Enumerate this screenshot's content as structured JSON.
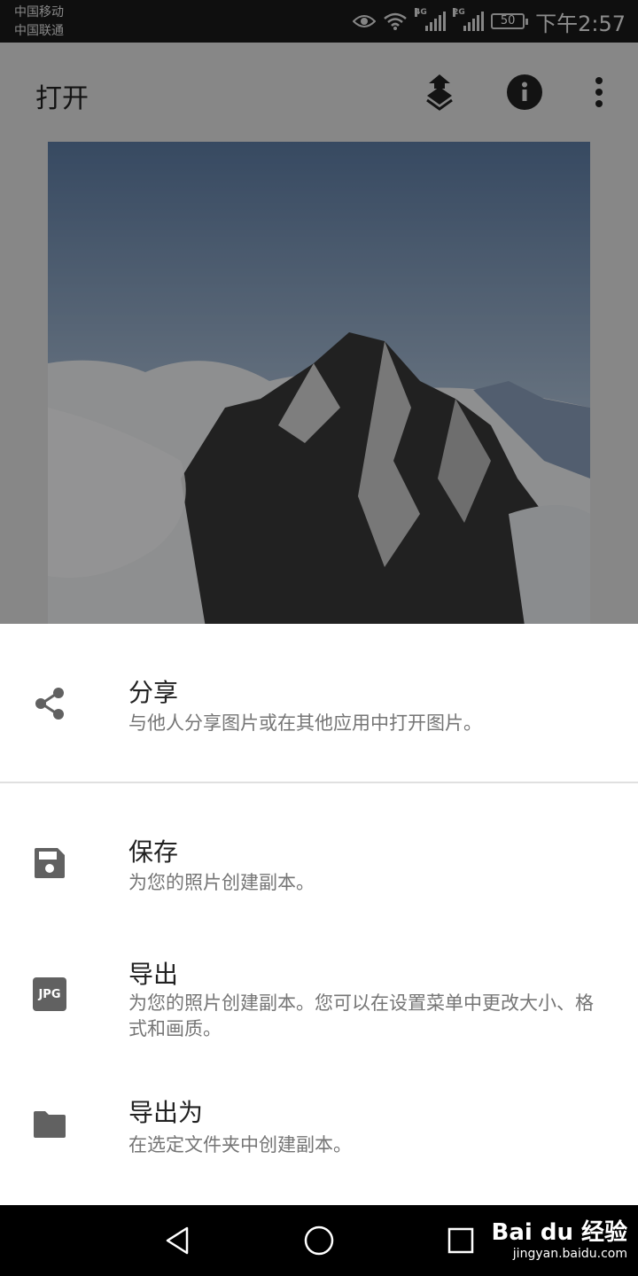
{
  "status_bar": {
    "carrier_1": "中国移动",
    "carrier_2": "中国联通",
    "signal_1_tag": "4G",
    "signal_2_tag": "2G",
    "battery": "50",
    "time": "下午2:57"
  },
  "app_bar": {
    "title": "打开",
    "actions": [
      "layers-icon",
      "info-icon",
      "more-vert-icon"
    ]
  },
  "sheet": {
    "items": [
      {
        "icon": "share-icon",
        "title": "分享",
        "description": "与他人分享图片或在其他应用中打开图片。"
      },
      {
        "icon": "save-icon",
        "title": "保存",
        "description": "为您的照片创建副本。"
      },
      {
        "icon": "jpg-icon",
        "icon_text": "JPG",
        "title": "导出",
        "description": "为您的照片创建副本。您可以在设置菜单中更改大小、格式和画质。"
      },
      {
        "icon": "folder-icon",
        "title": "导出为",
        "description": "在选定文件夹中创建副本。"
      }
    ]
  },
  "nav_bar": {
    "buttons": [
      "back-icon",
      "home-icon",
      "recents-icon"
    ]
  },
  "watermark": {
    "line1": "Bai du 经验",
    "line2": "jingyan.baidu.com"
  },
  "colors": {
    "sheet_bg": "#ffffff",
    "title_text": "#212121",
    "desc_text": "#757575",
    "icon_gray": "#616161",
    "divider": "#e0e0e0"
  }
}
